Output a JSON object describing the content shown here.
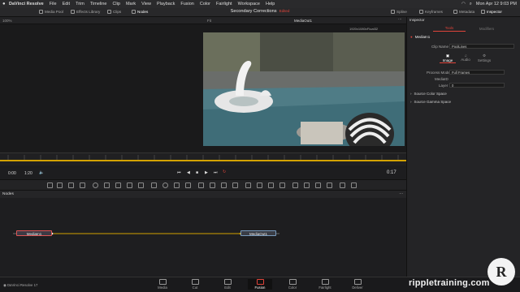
{
  "menubar": {
    "app_name": "DaVinci Resolve",
    "items": [
      "File",
      "Edit",
      "Trim",
      "Timeline",
      "Clip",
      "Mark",
      "View",
      "Playback",
      "Fusion",
      "Color",
      "Fairlight",
      "Workspace",
      "Help"
    ],
    "clock": "Mon Apr 12 9:03 PM"
  },
  "toolbar": {
    "left": [
      "Media Pool",
      "Effects Library",
      "Clips",
      "Nodes"
    ],
    "right": [
      "Spline",
      "Keyframes",
      "Metadata",
      "Inspector"
    ],
    "zoom": "100%"
  },
  "project": {
    "title": "Secondary Corrections",
    "status": "Edited"
  },
  "viewer": {
    "clip_label": "MediaOut1",
    "resolution": "1920x1080xFloat32",
    "scale": "Fit"
  },
  "timeline": {
    "start": "0:00",
    "end": "1:20",
    "current": "0:17"
  },
  "nodes": {
    "header": "Nodes",
    "items": [
      "MediaIn1",
      "MediaOut1"
    ]
  },
  "inspector": {
    "tabs": [
      "Tools",
      "Modifiers"
    ],
    "node_name": "MediaIn1",
    "clip_name_label": "Clip Name",
    "clip_name_value": "PoolLines",
    "subtabs": [
      "Image",
      "Audio",
      "Settings"
    ],
    "process_mode_label": "Process Mode",
    "process_mode_value": "Full Frames",
    "mediaid_label": "MediaID",
    "layer_label": "Layer",
    "layer_value": "0",
    "sections": [
      "Source Color Space",
      "Source Gamma Space"
    ]
  },
  "pagebar": {
    "app_version": "DaVinci Resolve 17",
    "pages": [
      "Media",
      "Cut",
      "Edit",
      "Fusion",
      "Color",
      "Fairlight",
      "Deliver"
    ],
    "active": "Fusion"
  },
  "watermark": {
    "text": "rippletraining.com",
    "logo": "R"
  },
  "colors": {
    "accent": "#e0443a",
    "playhead": "#d3a200",
    "link": "#d3a200"
  }
}
